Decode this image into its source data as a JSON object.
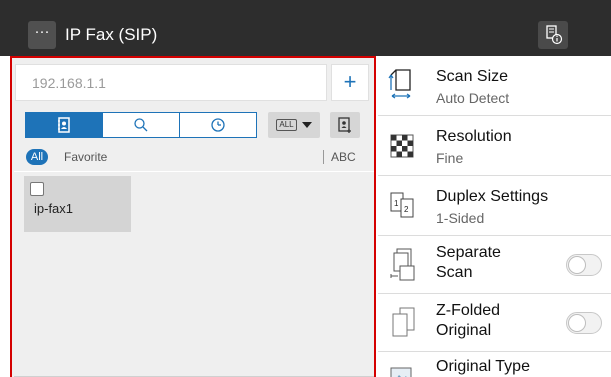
{
  "header": {
    "title": "IP Fax (SIP)",
    "menu_glyph": "···",
    "menu_icon": "ellipsis-icon",
    "job_icon": "job-info-icon"
  },
  "address": {
    "value": "192.168.1.1",
    "add_label": "+"
  },
  "tabs": [
    {
      "name": "address-book",
      "icon": "address-book-icon",
      "active": true
    },
    {
      "name": "search",
      "icon": "search-icon",
      "active": false
    },
    {
      "name": "history",
      "icon": "clock-icon",
      "active": false
    }
  ],
  "filter": {
    "index_badge": "ALL",
    "pill_label": "All",
    "favorite_label": "Favorite",
    "abc_label": "ABC"
  },
  "destinations": [
    {
      "label": "ip-fax1",
      "checked": false
    }
  ],
  "settings": [
    {
      "title": "Scan Size",
      "value": "Auto Detect",
      "icon": "scan-size-icon"
    },
    {
      "title": "Resolution",
      "value": "Fine",
      "icon": "resolution-icon"
    },
    {
      "title": "Duplex Settings",
      "value": "1-Sided",
      "icon": "duplex-icon"
    },
    {
      "title_line1": "Separate",
      "title_line2": "Scan",
      "icon": "separate-scan-icon",
      "toggle": false
    },
    {
      "title_line1": "Z-Folded",
      "title_line2": "Original",
      "icon": "z-folded-icon",
      "toggle": false
    },
    {
      "title": "Original Type",
      "icon": "original-type-icon"
    }
  ],
  "colors": {
    "header_bg": "#2d2d2d",
    "accent": "#1e73b8",
    "focus_border": "#d40000",
    "panel_bg": "#efefef"
  }
}
